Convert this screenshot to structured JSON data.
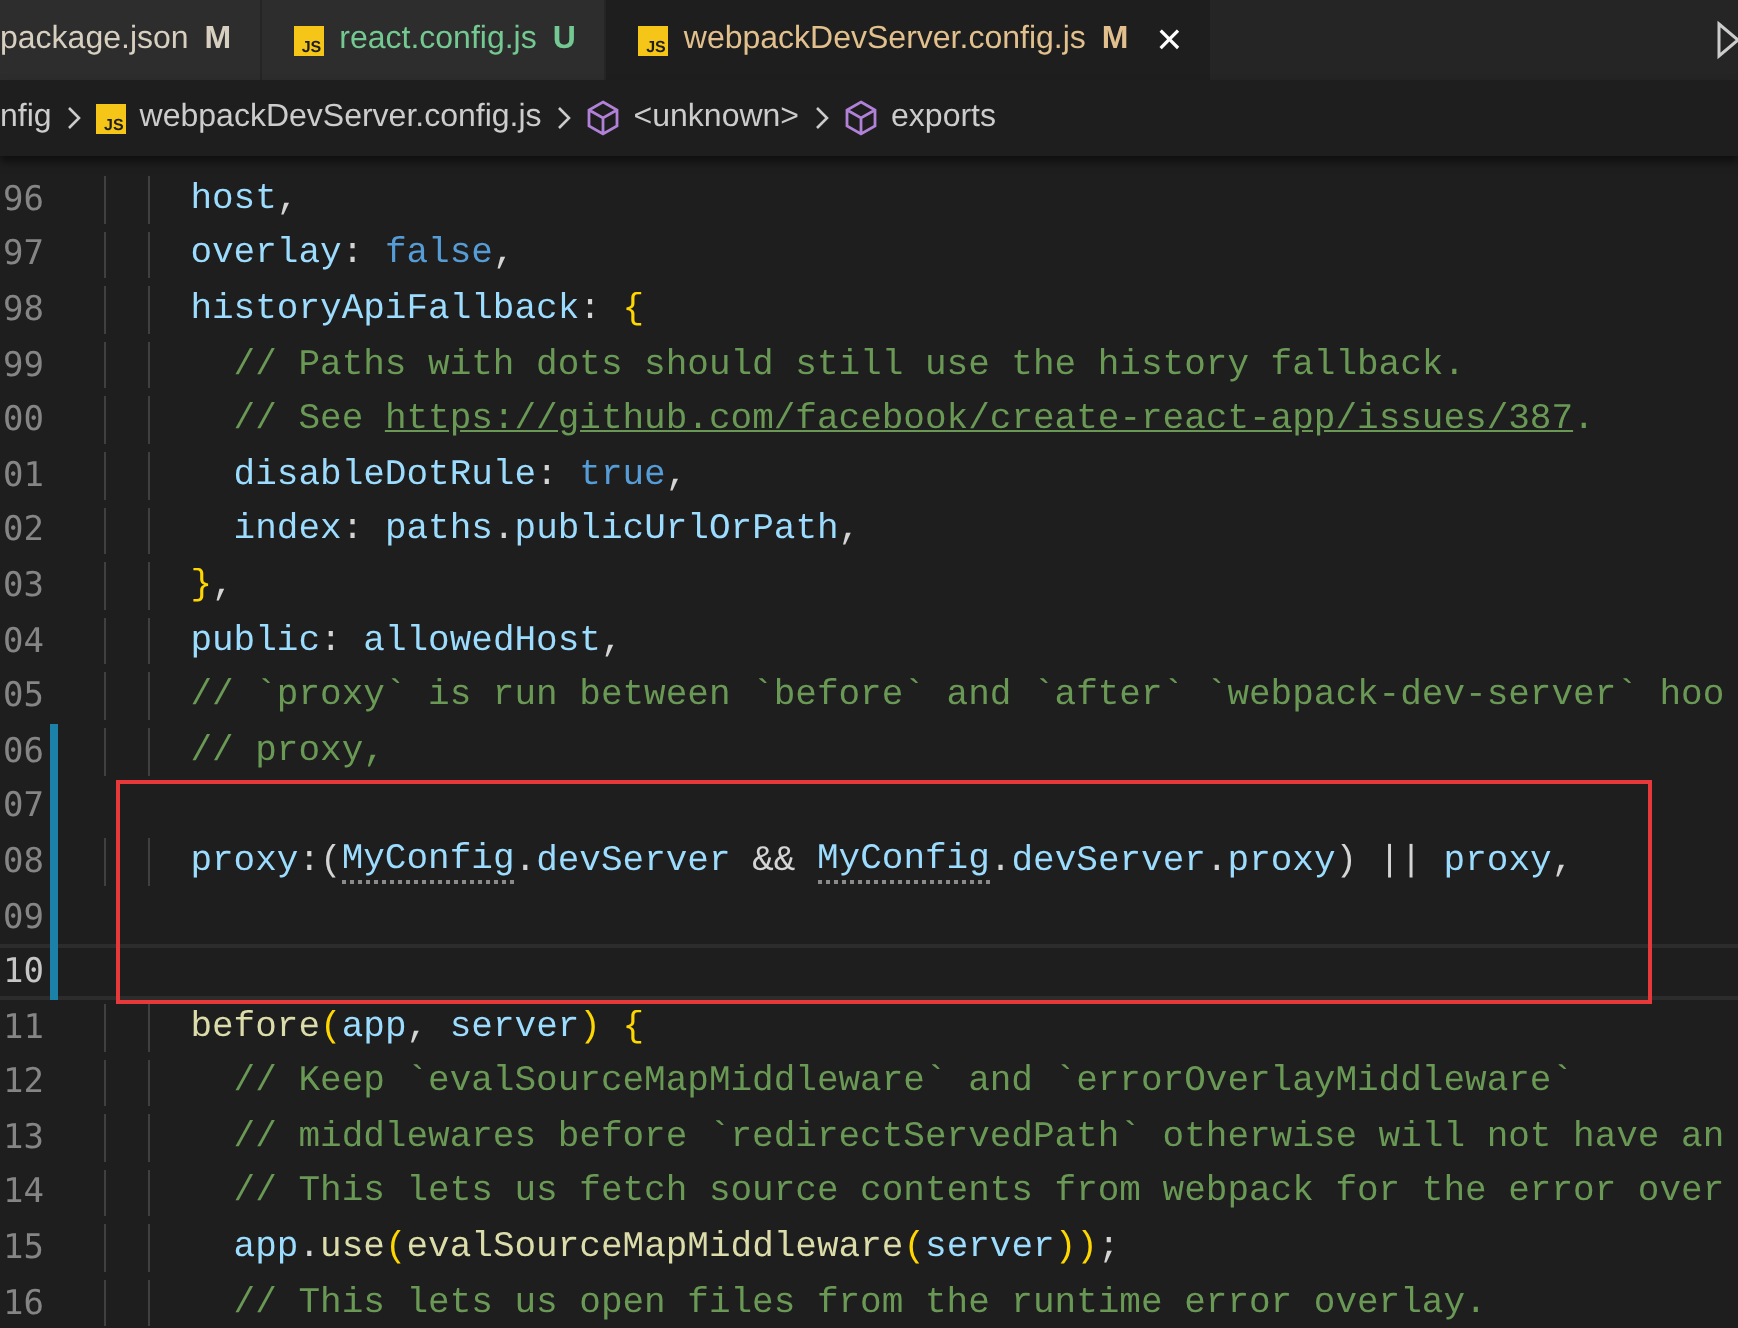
{
  "tabs": [
    {
      "label": "package.json",
      "status": "M",
      "color": "#d7cfc0",
      "selected": false
    },
    {
      "label": "react.config.js",
      "icon": "JS",
      "status": "U",
      "color": "#73c991",
      "selected": false
    },
    {
      "label": "webpackDevServer.config.js",
      "icon": "JS",
      "status": "M",
      "color": "#e2c08d",
      "selected": true,
      "close": "×"
    }
  ],
  "breadcrumbs": [
    {
      "kind": "folder",
      "label": "nfig"
    },
    {
      "kind": "file",
      "icon": "JS",
      "label": "webpackDevServer.config.js"
    },
    {
      "kind": "symbol",
      "label": "<unknown>"
    },
    {
      "kind": "symbol",
      "label": "exports"
    }
  ],
  "lines": [
    {
      "number": "96",
      "modified": false,
      "current": false,
      "tokens": [
        {
          "kind": "prop",
          "text": "    host"
        },
        {
          "kind": "plain",
          "text": ","
        }
      ]
    },
    {
      "number": "97",
      "modified": false,
      "current": false,
      "tokens": [
        {
          "kind": "prop",
          "text": "    overlay"
        },
        {
          "kind": "plain",
          "text": ": "
        },
        {
          "kind": "keyword",
          "text": "false"
        },
        {
          "kind": "plain",
          "text": ","
        }
      ]
    },
    {
      "number": "98",
      "modified": false,
      "current": false,
      "tokens": [
        {
          "kind": "prop",
          "text": "    historyApiFallback"
        },
        {
          "kind": "plain",
          "text": ": "
        },
        {
          "kind": "bracket",
          "text": "{"
        }
      ]
    },
    {
      "number": "99",
      "modified": false,
      "current": false,
      "tokens": [
        {
          "kind": "comment",
          "text": "      // Paths with dots should still use the history fallback."
        }
      ]
    },
    {
      "number": "00",
      "modified": false,
      "current": false,
      "tokens": [
        {
          "kind": "comment",
          "text": "      // See "
        },
        {
          "kind": "link",
          "text": "https://github.com/facebook/create-react-app/issues/387"
        },
        {
          "kind": "comment",
          "text": "."
        }
      ]
    },
    {
      "number": "01",
      "modified": false,
      "current": false,
      "tokens": [
        {
          "kind": "prop",
          "text": "      disableDotRule"
        },
        {
          "kind": "plain",
          "text": ": "
        },
        {
          "kind": "keyword",
          "text": "true"
        },
        {
          "kind": "plain",
          "text": ","
        }
      ]
    },
    {
      "number": "02",
      "modified": false,
      "current": false,
      "tokens": [
        {
          "kind": "prop",
          "text": "      index"
        },
        {
          "kind": "plain",
          "text": ": "
        },
        {
          "kind": "prop",
          "text": "paths"
        },
        {
          "kind": "plain",
          "text": "."
        },
        {
          "kind": "prop",
          "text": "publicUrlOrPath"
        },
        {
          "kind": "plain",
          "text": ","
        }
      ]
    },
    {
      "number": "03",
      "modified": false,
      "current": false,
      "tokens": [
        {
          "kind": "bracket",
          "text": "    }"
        },
        {
          "kind": "plain",
          "text": ","
        }
      ]
    },
    {
      "number": "04",
      "modified": false,
      "current": false,
      "tokens": [
        {
          "kind": "prop",
          "text": "    public"
        },
        {
          "kind": "plain",
          "text": ": "
        },
        {
          "kind": "prop",
          "text": "allowedHost"
        },
        {
          "kind": "plain",
          "text": ","
        }
      ]
    },
    {
      "number": "05",
      "modified": false,
      "current": false,
      "tokens": [
        {
          "kind": "comment",
          "text": "    // `proxy` is run between `before` and `after` `webpack-dev-server` hoo"
        }
      ]
    },
    {
      "number": "06",
      "modified": true,
      "current": false,
      "tokens": [
        {
          "kind": "comment",
          "text": "    // proxy,"
        }
      ]
    },
    {
      "number": "07",
      "modified": true,
      "current": false
    },
    {
      "number": "08",
      "modified": true,
      "current": false,
      "tokens": [
        {
          "kind": "prop",
          "text": "    proxy"
        },
        {
          "kind": "plain",
          "text": ":("
        },
        {
          "kind": "hint",
          "text": "MyConfig"
        },
        {
          "kind": "plain",
          "text": "."
        },
        {
          "kind": "prop",
          "text": "devServer"
        },
        {
          "kind": "plain",
          "text": " && "
        },
        {
          "kind": "hint",
          "text": "MyConfig"
        },
        {
          "kind": "plain",
          "text": "."
        },
        {
          "kind": "prop",
          "text": "devServer"
        },
        {
          "kind": "plain",
          "text": "."
        },
        {
          "kind": "prop",
          "text": "proxy"
        },
        {
          "kind": "plain",
          "text": ") || "
        },
        {
          "kind": "prop",
          "text": "proxy"
        },
        {
          "kind": "plain",
          "text": ","
        }
      ]
    },
    {
      "number": "09",
      "modified": true,
      "current": false
    },
    {
      "number": "10",
      "modified": true,
      "current": true
    },
    {
      "number": "11",
      "modified": false,
      "current": false,
      "tokens": [
        {
          "kind": "func",
          "text": "    before"
        },
        {
          "kind": "bracket",
          "text": "("
        },
        {
          "kind": "prop",
          "text": "app"
        },
        {
          "kind": "plain",
          "text": ", "
        },
        {
          "kind": "prop",
          "text": "server"
        },
        {
          "kind": "bracket",
          "text": ")"
        },
        {
          "kind": "bracket",
          "text": " {"
        }
      ]
    },
    {
      "number": "12",
      "modified": false,
      "current": false,
      "tokens": [
        {
          "kind": "comment",
          "text": "      // Keep `evalSourceMapMiddleware` and `errorOverlayMiddleware`"
        }
      ]
    },
    {
      "number": "13",
      "modified": false,
      "current": false,
      "tokens": [
        {
          "kind": "comment",
          "text": "      // middlewares before `redirectServedPath` otherwise will not have an"
        }
      ]
    },
    {
      "number": "14",
      "modified": false,
      "current": false,
      "tokens": [
        {
          "kind": "comment",
          "text": "      // This lets us fetch source contents from webpack for the error over"
        }
      ]
    },
    {
      "number": "15",
      "modified": false,
      "current": false,
      "tokens": [
        {
          "kind": "prop",
          "text": "      app"
        },
        {
          "kind": "plain",
          "text": "."
        },
        {
          "kind": "func",
          "text": "use"
        },
        {
          "kind": "bracket",
          "text": "("
        },
        {
          "kind": "func",
          "text": "evalSourceMapMiddleware"
        },
        {
          "kind": "bracket",
          "text": "("
        },
        {
          "kind": "prop",
          "text": "server"
        },
        {
          "kind": "bracket",
          "text": "))"
        },
        {
          "kind": "plain",
          "text": ";"
        }
      ]
    },
    {
      "number": "16",
      "modified": false,
      "current": false,
      "tokens": [
        {
          "kind": "comment",
          "text": "      // This lets us open files from the runtime error overlay."
        }
      ]
    }
  ]
}
